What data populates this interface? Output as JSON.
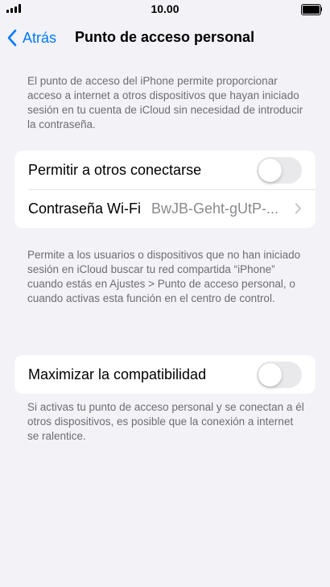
{
  "status_bar": {
    "time": "10.00",
    "signal_icon": "signal-bars-icon",
    "battery_icon": "battery-full-icon"
  },
  "nav": {
    "back_label": "Atrás",
    "back_icon": "chevron-left-icon",
    "title": "Punto de acceso personal"
  },
  "intro_text": "El punto de acceso del iPhone permite proporcionar acceso a internet a otros dispositivos que hayan iniciado sesión en tu cuenta de iCloud sin necesidad de introducir la contraseña.",
  "hotspot_group": {
    "allow_others": {
      "label": "Permitir a otros conectarse",
      "enabled": false
    },
    "wifi_password": {
      "label": "Contraseña Wi-Fi",
      "value": "BwJB-Geht-gUtP-...",
      "icon": "chevron-right-icon"
    }
  },
  "hotspot_footer": "Permite a los usuarios o dispositivos que no han iniciado sesión en iCloud buscar tu red compartida “iPhone” cuando estás en Ajustes > Punto de acceso personal, o cuando activas esta función en el centro de control.",
  "compat_group": {
    "maximize": {
      "label": "Maximizar la compatibilidad",
      "enabled": false
    }
  },
  "compat_footer": "Si activas tu punto de acceso personal y se conectan a él otros dispositivos, es posible que la conexión a internet se ralentice.",
  "colors": {
    "accent": "#007aff",
    "background": "#f2f2f7",
    "toggle_off": "#e9e9eb",
    "secondary_text": "#6d6d72"
  }
}
